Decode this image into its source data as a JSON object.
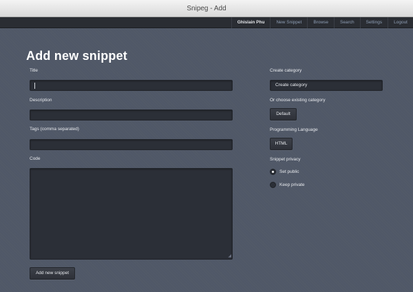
{
  "window": {
    "title": "Snipeg - Add"
  },
  "nav": {
    "user": "Ghislain Phu",
    "items": [
      "New Snippet",
      "Browse",
      "Search",
      "Settings",
      "Logout"
    ]
  },
  "page": {
    "title": "Add new snippet"
  },
  "form": {
    "title_label": "Title",
    "title_value": "",
    "description_label": "Description",
    "description_value": "",
    "tags_label": "Tags (comma separated)",
    "tags_value": "",
    "code_label": "Code",
    "code_value": "",
    "submit_label": "Add new snippet"
  },
  "sidebar": {
    "create_category_label": "Create category",
    "create_category_placeholder": "Create category",
    "existing_category_label": "Or choose existing category",
    "existing_category_value": "Default",
    "language_label": "Programming Language",
    "language_value": "HTML",
    "privacy_label": "Snippet privacy",
    "privacy_options": [
      {
        "label": "Set public",
        "checked": true
      },
      {
        "label": "Keep private",
        "checked": false
      }
    ]
  },
  "colors": {
    "background": "#505867",
    "navbar": "#2a2d33",
    "input": "#2b2f37",
    "nav_link": "#8f9fb6"
  }
}
